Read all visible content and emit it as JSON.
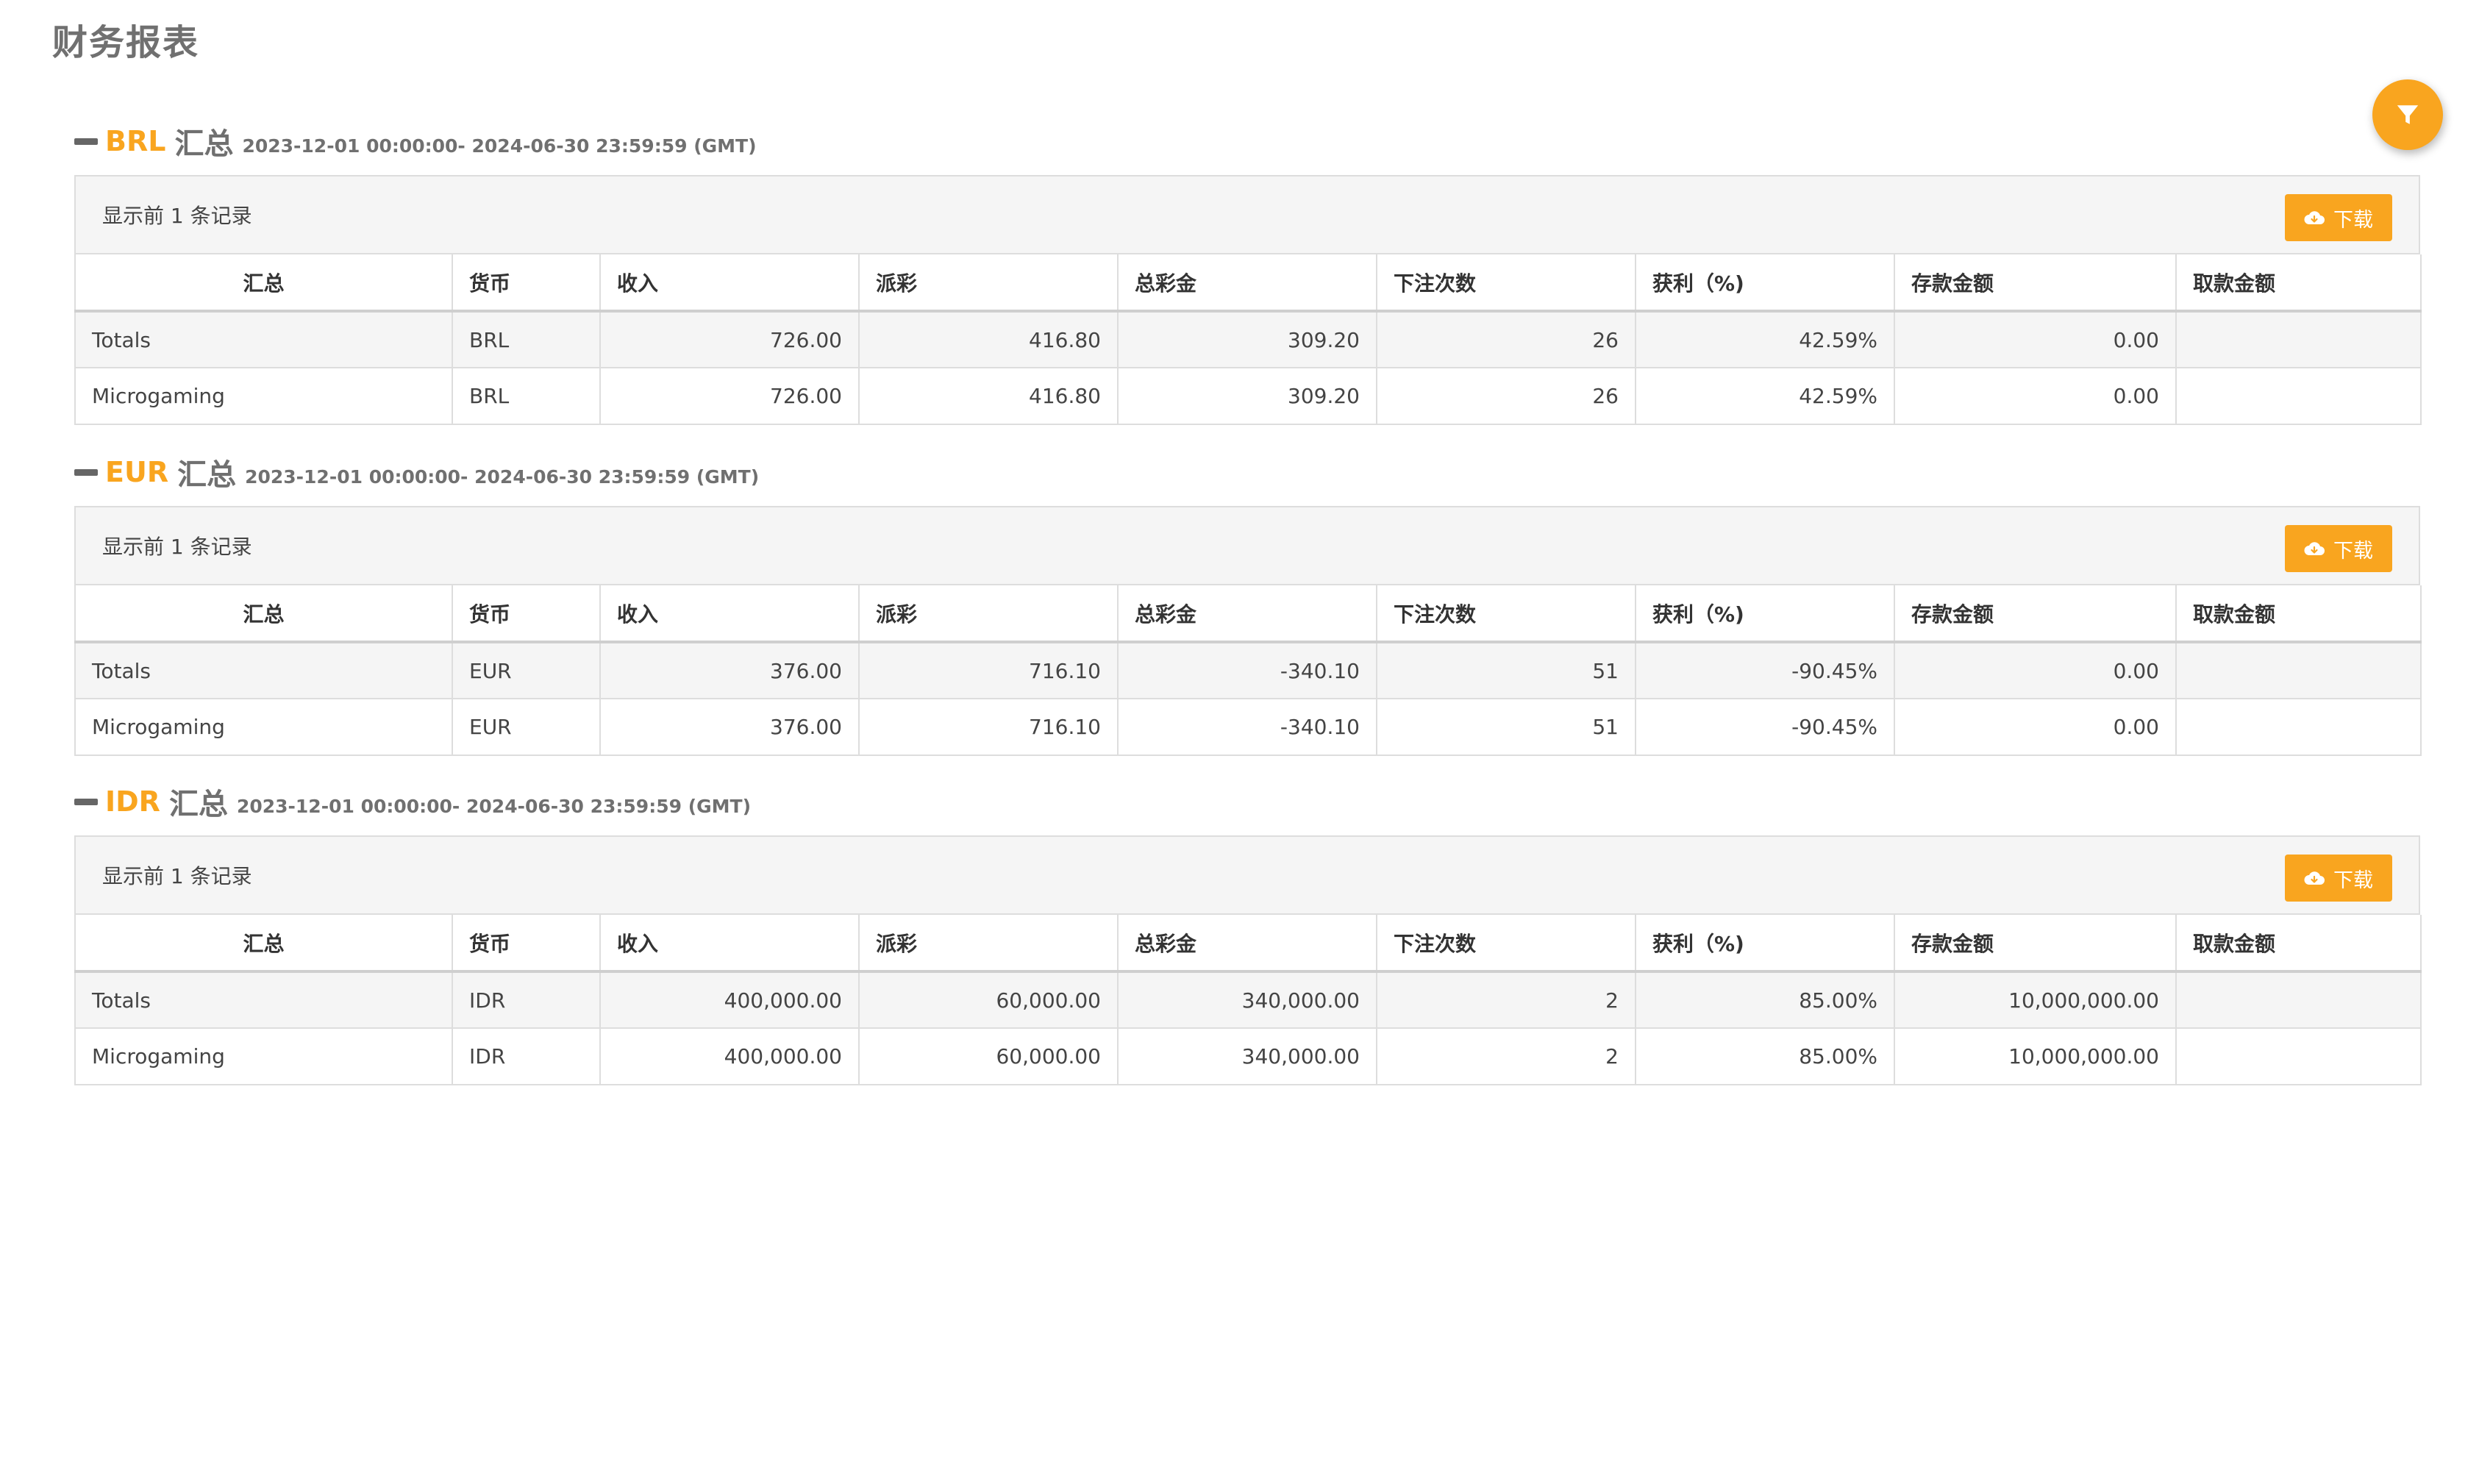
{
  "page": {
    "title": "财务报表"
  },
  "filter": {
    "icon": "filter-icon"
  },
  "columns": [
    "汇总",
    "货币",
    "收入",
    "派彩",
    "总彩金",
    "下注次数",
    "获利（%)",
    "存款金额",
    "取款金额"
  ],
  "sections": [
    {
      "currency": "BRL",
      "summary_label": "汇总",
      "date_range": "2023-12-01 00:00:00- 2024-06-30 23:59:59 (GMT)",
      "record_count": "显示前 1 条记录",
      "download_label": "下载",
      "rows": [
        [
          "Totals",
          "BRL",
          "726.00",
          "416.80",
          "309.20",
          "26",
          "42.59%",
          "0.00",
          ""
        ],
        [
          "Microgaming",
          "BRL",
          "726.00",
          "416.80",
          "309.20",
          "26",
          "42.59%",
          "0.00",
          ""
        ]
      ]
    },
    {
      "currency": "EUR",
      "summary_label": "汇总",
      "date_range": "2023-12-01 00:00:00- 2024-06-30 23:59:59 (GMT)",
      "record_count": "显示前 1 条记录",
      "download_label": "下载",
      "rows": [
        [
          "Totals",
          "EUR",
          "376.00",
          "716.10",
          "-340.10",
          "51",
          "-90.45%",
          "0.00",
          ""
        ],
        [
          "Microgaming",
          "EUR",
          "376.00",
          "716.10",
          "-340.10",
          "51",
          "-90.45%",
          "0.00",
          ""
        ]
      ]
    },
    {
      "currency": "IDR",
      "summary_label": "汇总",
      "date_range": "2023-12-01 00:00:00- 2024-06-30 23:59:59 (GMT)",
      "record_count": "显示前 1 条记录",
      "download_label": "下载",
      "rows": [
        [
          "Totals",
          "IDR",
          "400,000.00",
          "60,000.00",
          "340,000.00",
          "2",
          "85.00%",
          "10,000,000.00",
          ""
        ],
        [
          "Microgaming",
          "IDR",
          "400,000.00",
          "60,000.00",
          "340,000.00",
          "2",
          "85.00%",
          "10,000,000.00",
          ""
        ]
      ]
    }
  ],
  "colors": {
    "accent": "#f9a51f",
    "title": "#707070",
    "panel_bg": "#f5f5f5",
    "border": "#dddddd"
  }
}
